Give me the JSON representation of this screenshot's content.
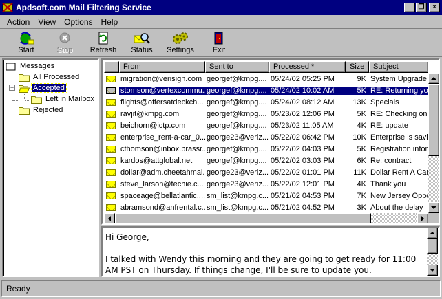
{
  "window": {
    "title": "Apdsoft.com Mail Filtering Service",
    "minimize": "_",
    "restore": "❐",
    "close": "×"
  },
  "menu": [
    "Action",
    "View",
    "Options",
    "Help"
  ],
  "toolbar": [
    {
      "label": "Start",
      "icon": "start-icon",
      "enabled": true
    },
    {
      "label": "Stop",
      "icon": "stop-icon",
      "enabled": false
    },
    {
      "label": "Refresh",
      "icon": "refresh-icon",
      "enabled": true
    },
    {
      "label": "Status",
      "icon": "status-icon",
      "enabled": true
    },
    {
      "label": "Settings",
      "icon": "settings-icon",
      "enabled": true
    },
    {
      "label": "Exit",
      "icon": "exit-icon",
      "enabled": true
    }
  ],
  "tree": {
    "root": "Messages",
    "items": [
      "All Processed",
      "Accepted",
      "Left in Mailbox",
      "Rejected"
    ],
    "selected": "Accepted"
  },
  "list": {
    "columns": [
      "From",
      "Sent to",
      "Processed *",
      "Size",
      "Subject"
    ],
    "selected_index": 1,
    "rows": [
      {
        "from": "migration@verisign.com",
        "to": "georgef@kmpg....",
        "processed": "05/24/02 05:25 PM",
        "size": "9K",
        "subject": "System Upgrade N"
      },
      {
        "from": "stomson@vertexcommu...",
        "to": "georgef@kmpg....",
        "processed": "05/24/02 10:02 AM",
        "size": "5K",
        "subject": "RE: Returning you"
      },
      {
        "from": "flights@offersatdeckch...",
        "to": "georgef@kmpg....",
        "processed": "05/24/02 08:12 AM",
        "size": "13K",
        "subject": "Specials"
      },
      {
        "from": "ravjit@kmpg.com",
        "to": "georgef@kmpg....",
        "processed": "05/23/02 12:06 PM",
        "size": "5K",
        "subject": "RE: Checking on"
      },
      {
        "from": "beichorn@ictp.com",
        "to": "georgef@kmpg....",
        "processed": "05/23/02 11:05 AM",
        "size": "4K",
        "subject": "RE: update"
      },
      {
        "from": "enterprise_rent-a-car_0...",
        "to": "george23@veriz...",
        "processed": "05/22/02 06:42 PM",
        "size": "10K",
        "subject": "Enterprise is savir"
      },
      {
        "from": "cthomson@inbox.brassr...",
        "to": "georgef@kmpg....",
        "processed": "05/22/02 04:03 PM",
        "size": "5K",
        "subject": "Registration inform"
      },
      {
        "from": "kardos@attglobal.net",
        "to": "georgef@kmpg....",
        "processed": "05/22/02 03:03 PM",
        "size": "6K",
        "subject": "Re: contract"
      },
      {
        "from": "dollar@adm.cheetahmai...",
        "to": "george23@veriz...",
        "processed": "05/22/02 01:01 PM",
        "size": "11K",
        "subject": "Dollar Rent A Car"
      },
      {
        "from": "steve_larson@techie.c...",
        "to": "george23@veriz...",
        "processed": "05/22/02 12:01 PM",
        "size": "4K",
        "subject": "Thank you"
      },
      {
        "from": "spaceage@bellatlantic....",
        "to": "sm_list@kmpg.c...",
        "processed": "05/21/02 04:53 PM",
        "size": "7K",
        "subject": "New Jersey Oppo"
      },
      {
        "from": "abramsond@anfrental.c...",
        "to": "sm_list@kmpg.c...",
        "processed": "05/21/02 04:52 PM",
        "size": "3K",
        "subject": "About the delay"
      }
    ]
  },
  "preview": {
    "text": "Hi George,\n\nI talked with Wendy this morning and they are going to get ready for 11:00 AM PST on Thursday. If things change, I'll be sure to update you."
  },
  "status": "Ready",
  "colors": {
    "titlebar": "#000080",
    "face": "#c0c0c0",
    "selection": "#000080",
    "envelope": "#ffff00",
    "folder": "#ffff99"
  }
}
